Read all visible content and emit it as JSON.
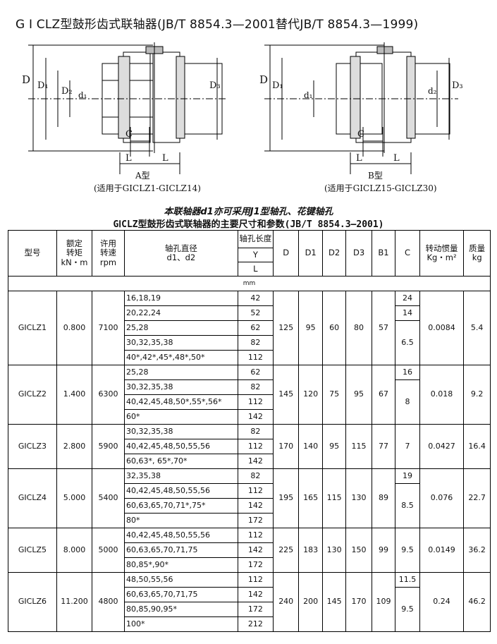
{
  "title": "G Ⅰ CLZ型鼓形齿式联轴器(JB/T 8854.3—2001替代JB/T 8854.3—1999)",
  "drawings": {
    "a": {
      "caption": "A型",
      "applies": "(适用于GⅠCLZ1-GⅠCLZ14)",
      "dims": {
        "D": "D",
        "D1": "D₁",
        "D2": "D₂",
        "D3": "D₃",
        "d1": "d₁",
        "C": "C",
        "L": "L"
      }
    },
    "b": {
      "caption": "B型",
      "applies": "(适用于GⅠCLZ15-GⅠCLZ30)",
      "dims": {
        "D": "D",
        "D1": "D₁",
        "d1": "d₁",
        "d2": "d₂",
        "D3": "D₃",
        "C": "C",
        "L": "L"
      }
    }
  },
  "note1": "本联轴器d1亦可采用J1型轴孔、花键轴孔",
  "note2": "GⅠCLZ型鼓形齿式联轴器的主要尺寸和参数(JB/T 8854.3—2001)",
  "headers": {
    "model": "型号",
    "torque": "额定\n转矩\nkN・m",
    "speed": "许用\n转速\nrpm",
    "bore": "轴孔直径\nd1、d2",
    "length": "轴孔长度",
    "Y": "Y",
    "L": "L",
    "D": "D",
    "D1": "D1",
    "D2": "D2",
    "D3": "D3",
    "B1": "B1",
    "C": "C",
    "inertia": "转动惯量\nKg・m²",
    "mass": "质量\nkg",
    "unit": "mm"
  },
  "models": [
    {
      "name": "GⅠCLZ1",
      "torque": "0.800",
      "speed": "7100",
      "D": "125",
      "D1": "95",
      "D2": "60",
      "D3": "80",
      "B1": "57",
      "inertia": "0.0084",
      "mass": "5.4",
      "rows": [
        {
          "bore": "16,18,19",
          "len": "42"
        },
        {
          "bore": "20,22,24",
          "len": "52"
        },
        {
          "bore": "25,28",
          "len": "62"
        },
        {
          "bore": "30,32,35,38",
          "len": "82"
        },
        {
          "bore": "40*,42*,45*,48*,50*",
          "len": "112"
        }
      ],
      "c": [
        {
          "v": "24",
          "span": 1
        },
        {
          "v": "14",
          "span": 1
        },
        {
          "v": "6.5",
          "span": 3
        }
      ]
    },
    {
      "name": "GⅠCLZ2",
      "torque": "1.400",
      "speed": "6300",
      "D": "145",
      "D1": "120",
      "D2": "75",
      "D3": "95",
      "B1": "67",
      "inertia": "0.018",
      "mass": "9.2",
      "rows": [
        {
          "bore": "25,28",
          "len": "62"
        },
        {
          "bore": "30,32,35,38",
          "len": "82"
        },
        {
          "bore": "40,42,45,48,50*,55*,56*",
          "len": "112"
        },
        {
          "bore": "60*",
          "len": "142"
        }
      ],
      "c": [
        {
          "v": "16",
          "span": 1
        },
        {
          "v": "8",
          "span": 3
        }
      ]
    },
    {
      "name": "GⅠCLZ3",
      "torque": "2.800",
      "speed": "5900",
      "D": "170",
      "D1": "140",
      "D2": "95",
      "D3": "115",
      "B1": "77",
      "inertia": "0.0427",
      "mass": "16.4",
      "rows": [
        {
          "bore": "30,32,35,38",
          "len": "82"
        },
        {
          "bore": "40,42,45,48,50,55,56",
          "len": "112"
        },
        {
          "bore": "60,63*, 65*,70*",
          "len": "142"
        }
      ],
      "c": [
        {
          "v": "7",
          "span": 3
        }
      ]
    },
    {
      "name": "GⅠCLZ4",
      "torque": "5.000",
      "speed": "5400",
      "D": "195",
      "D1": "165",
      "D2": "115",
      "D3": "130",
      "B1": "89",
      "inertia": "0.076",
      "mass": "22.7",
      "rows": [
        {
          "bore": "32,35,38",
          "len": "82"
        },
        {
          "bore": "40,42,45,48,50,55,56",
          "len": "112"
        },
        {
          "bore": "60,63,65,70,71*,75*",
          "len": "142"
        },
        {
          "bore": "80*",
          "len": "172"
        }
      ],
      "c": [
        {
          "v": "19",
          "span": 1
        },
        {
          "v": "8.5",
          "span": 3
        }
      ]
    },
    {
      "name": "GⅠCLZ5",
      "torque": "8.000",
      "speed": "5000",
      "D": "225",
      "D1": "183",
      "D2": "130",
      "D3": "150",
      "B1": "99",
      "inertia": "0.0149",
      "mass": "36.2",
      "rows": [
        {
          "bore": "40,42,45,48,50,55,56",
          "len": "112"
        },
        {
          "bore": "60,63,65,70,71,75",
          "len": "142"
        },
        {
          "bore": "80,85*,90*",
          "len": "172"
        }
      ],
      "c": [
        {
          "v": "9.5",
          "span": 3
        }
      ]
    },
    {
      "name": "GⅠCLZ6",
      "torque": "11.200",
      "speed": "4800",
      "D": "240",
      "D1": "200",
      "D2": "145",
      "D3": "170",
      "B1": "109",
      "inertia": "0.24",
      "mass": "46.2",
      "rows": [
        {
          "bore": "48,50,55,56",
          "len": "112"
        },
        {
          "bore": "60,63,65,70,71,75",
          "len": "142"
        },
        {
          "bore": "80,85,90,95*",
          "len": "172"
        },
        {
          "bore": "100*",
          "len": "212"
        }
      ],
      "c": [
        {
          "v": "11.5",
          "span": 1
        },
        {
          "v": "9.5",
          "span": 3
        }
      ]
    }
  ]
}
